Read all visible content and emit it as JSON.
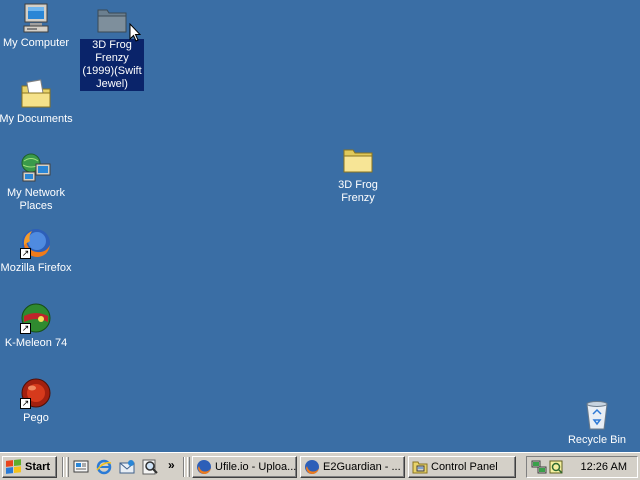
{
  "desktop": {
    "icons": [
      {
        "label": "My Computer",
        "icon": "computer-icon"
      },
      {
        "label": "3D Frog Frenzy (1999)(Swift Jewel)",
        "icon": "folder-icon",
        "selected": true
      },
      {
        "label": "My Documents",
        "icon": "documents-folder-icon"
      },
      {
        "label": "3D Frog Frenzy",
        "icon": "folder-icon"
      },
      {
        "label": "My Network Places",
        "icon": "network-icon"
      },
      {
        "label": "Mozilla Firefox",
        "icon": "firefox-icon",
        "shortcut": true
      },
      {
        "label": "K-Meleon 74",
        "icon": "k-meleon-icon",
        "shortcut": true
      },
      {
        "label": "Pego",
        "icon": "pego-icon",
        "shortcut": true
      },
      {
        "label": "Recycle Bin",
        "icon": "recycle-bin-icon"
      }
    ]
  },
  "taskbar": {
    "start_label": "Start",
    "quick_launch": [
      "show-desktop-icon",
      "internet-explorer-icon",
      "outlook-express-icon",
      "search-icon"
    ],
    "overflow_label": "»",
    "tasks": [
      {
        "label": "Ufile.io - Uploa...",
        "icon": "firefox-icon"
      },
      {
        "label": "E2Guardian - ...",
        "icon": "firefox-icon"
      },
      {
        "label": "Control Panel",
        "icon": "control-panel-icon"
      }
    ],
    "tray": {
      "icons": [
        "network-tray-icon",
        "security-tray-icon"
      ],
      "clock": "12:26 AM"
    }
  },
  "colors": {
    "desktop_background": "#3a6ea5",
    "selection": "#0a246a",
    "taskbar": "#d4d0c8"
  }
}
